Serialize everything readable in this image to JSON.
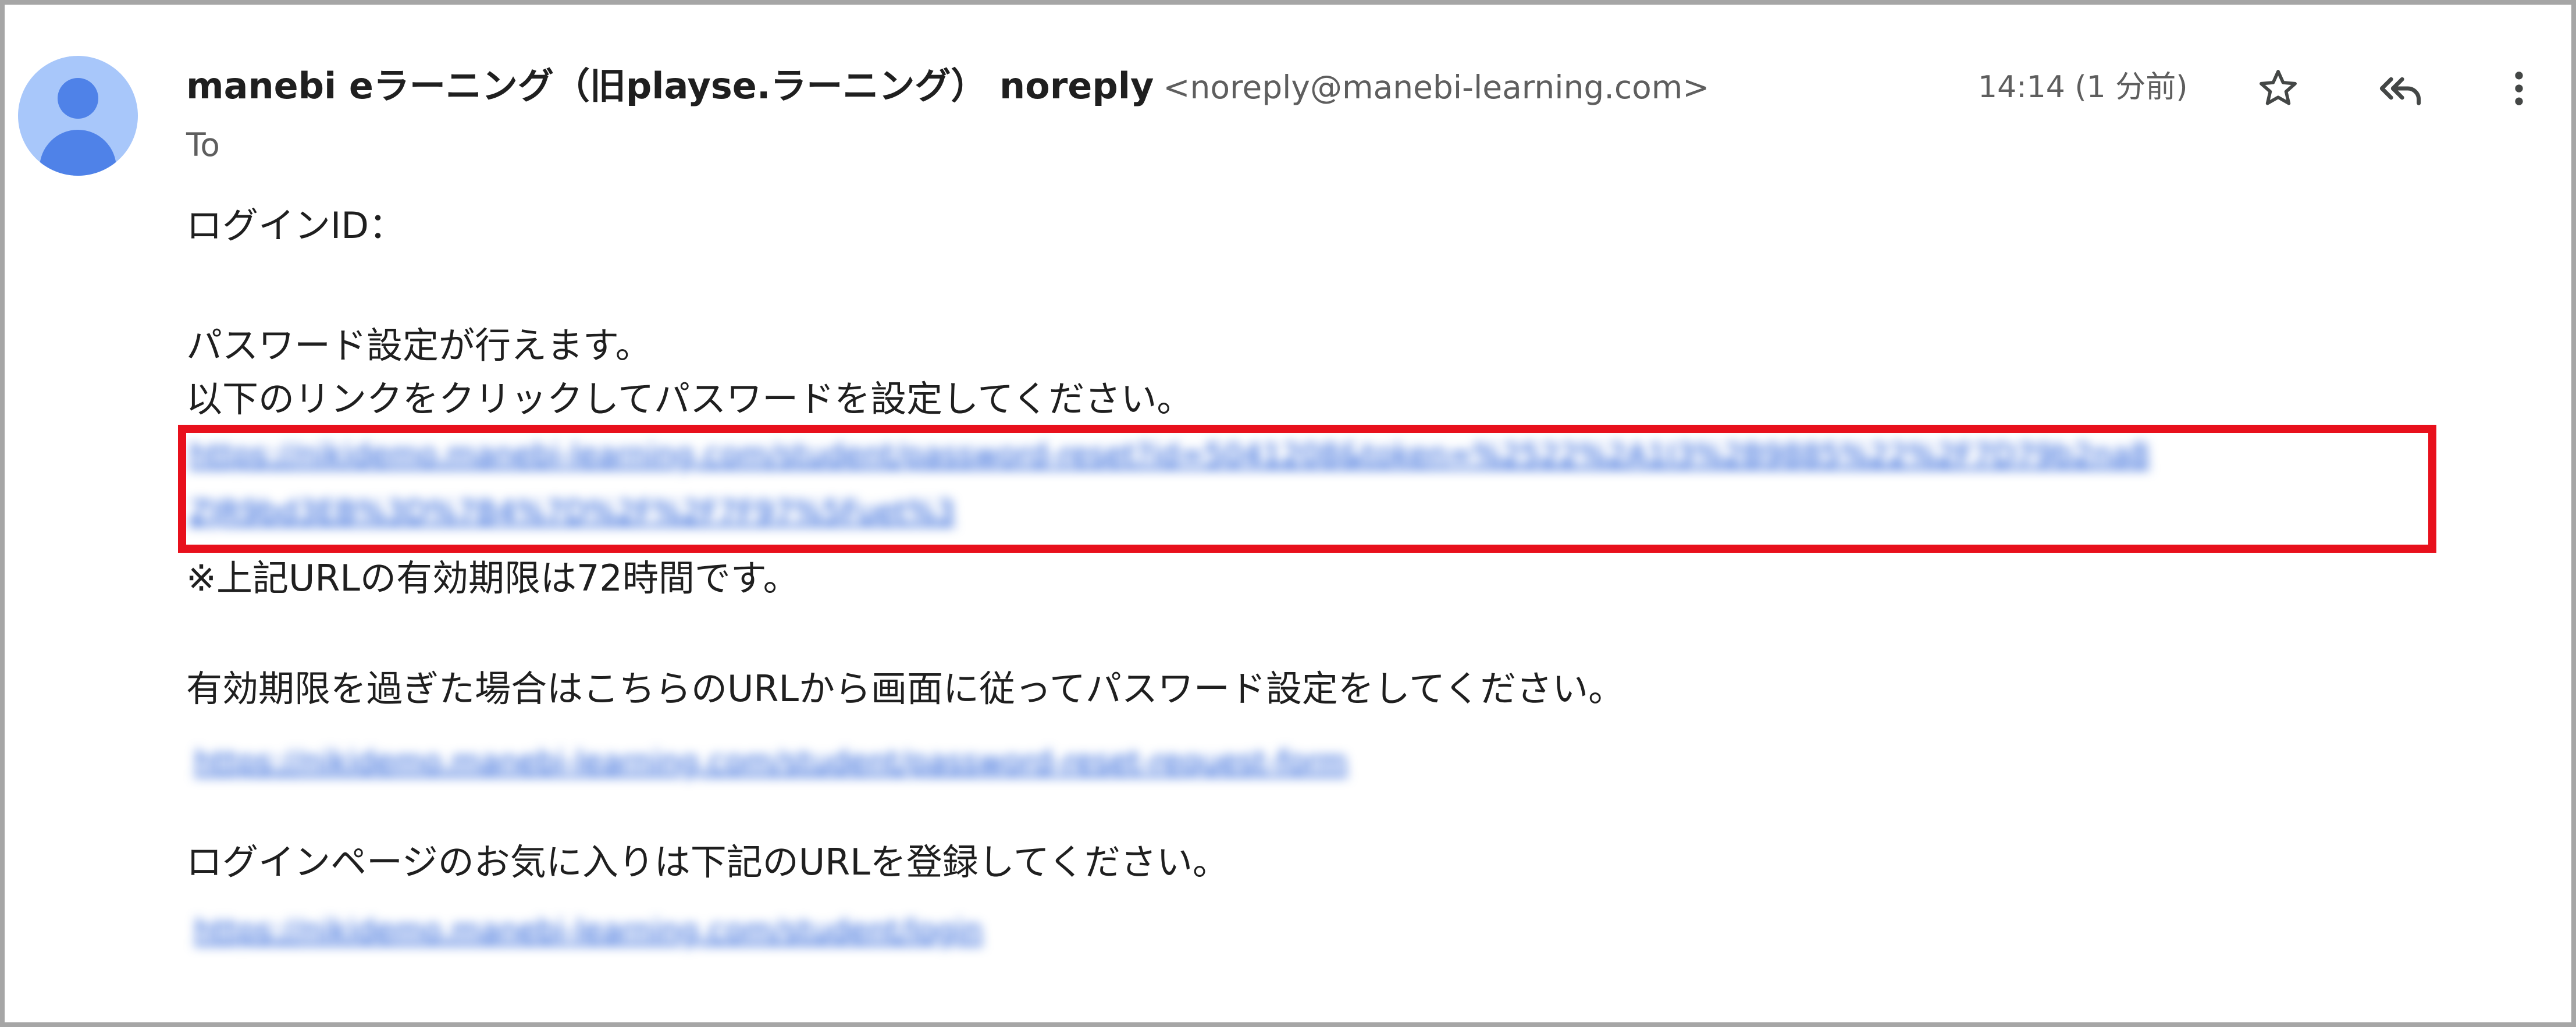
{
  "email": {
    "sender_name": "manebi eラーニング（旧playse.ラーニング） noreply",
    "sender_address": "<noreply@manebi-learning.com>",
    "to_label": "To",
    "timestamp": "14:14 (1 分前)"
  },
  "icons": {
    "avatar": "avatar-icon",
    "star": "star-icon",
    "reply_all": "reply-all-icon",
    "more": "more-vert-icon"
  },
  "colors": {
    "highlight_border": "#e8101c",
    "link": "#1a56d6",
    "avatar_bg": "#a8c7fa",
    "avatar_fg": "#4f82e8"
  },
  "body": {
    "login_id_label": "ログインID：",
    "password_setup_line": "パスワード設定が行えます。",
    "instruction_line": "以下のリンクをクリックしてパスワードを設定してください。",
    "reset_link_line1": "https://nikidemo.manebi-learning.com/student/password-reset?id=5041208&token=%2522%2A1I3%2B9885%22%2F7D79b2na8",
    "reset_link_line2": "ZJR9bd3EB%3D%7B4%7D%2F%2F7F97%5Fuet%3",
    "expiry_note": "※上記URLの有効期限は72時間です。",
    "expired_instruction": "有効期限を過ぎた場合はこちらのURLから画面に従ってパスワード設定をしてください。",
    "request_link": "https://nikidemo.manebi-learning.com/student/password-reset-request-form",
    "bookmark_instruction": "ログインページのお気に入りは下記のURLを登録してください。",
    "login_link": "https://nikidemo.manebi-learning.com/student/login"
  }
}
